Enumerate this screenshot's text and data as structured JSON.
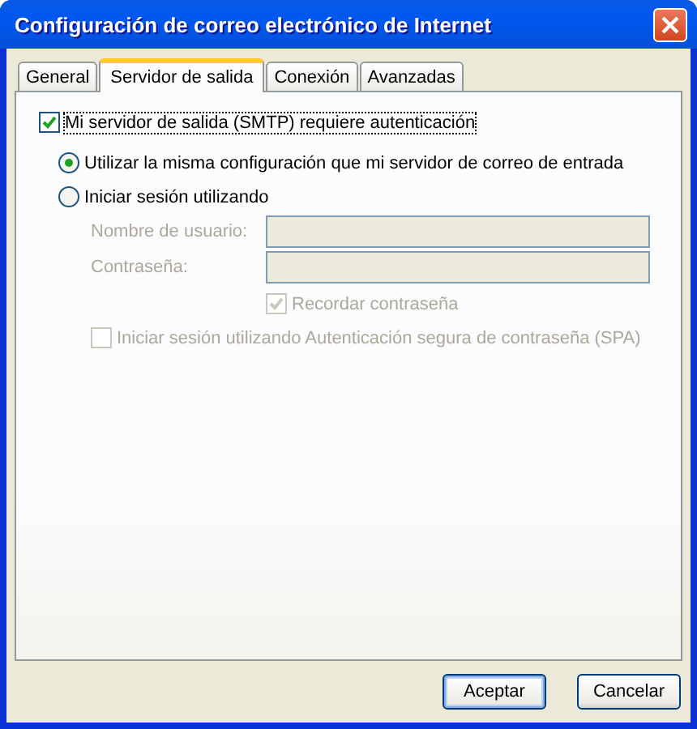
{
  "window": {
    "title": "Configuración de correo electrónico de Internet"
  },
  "tabs": [
    {
      "label": "General",
      "selected": false
    },
    {
      "label": "Servidor de salida",
      "selected": true
    },
    {
      "label": "Conexión",
      "selected": false
    },
    {
      "label": "Avanzadas",
      "selected": false
    }
  ],
  "smtp_auth": {
    "label": "Mi servidor de salida (SMTP) requiere autenticación",
    "checked": true,
    "focused": true
  },
  "options": [
    {
      "label": "Utilizar la misma configuración que mi servidor de correo de entrada",
      "selected": true
    },
    {
      "label": "Iniciar sesión utilizando",
      "selected": false
    }
  ],
  "fields": [
    {
      "label": "Nombre de usuario:",
      "disabled": true
    },
    {
      "label": "Contraseña:",
      "disabled": true
    }
  ],
  "remember_password": {
    "label": "Recordar contraseña",
    "checked": true,
    "disabled": true
  },
  "spa": {
    "label": "Iniciar sesión utilizando Autenticación segura de contraseña (SPA)",
    "checked": false,
    "disabled": true
  },
  "buttons": [
    {
      "label": "Aceptar",
      "default": true
    },
    {
      "label": "Cancelar",
      "default": false
    }
  ]
}
